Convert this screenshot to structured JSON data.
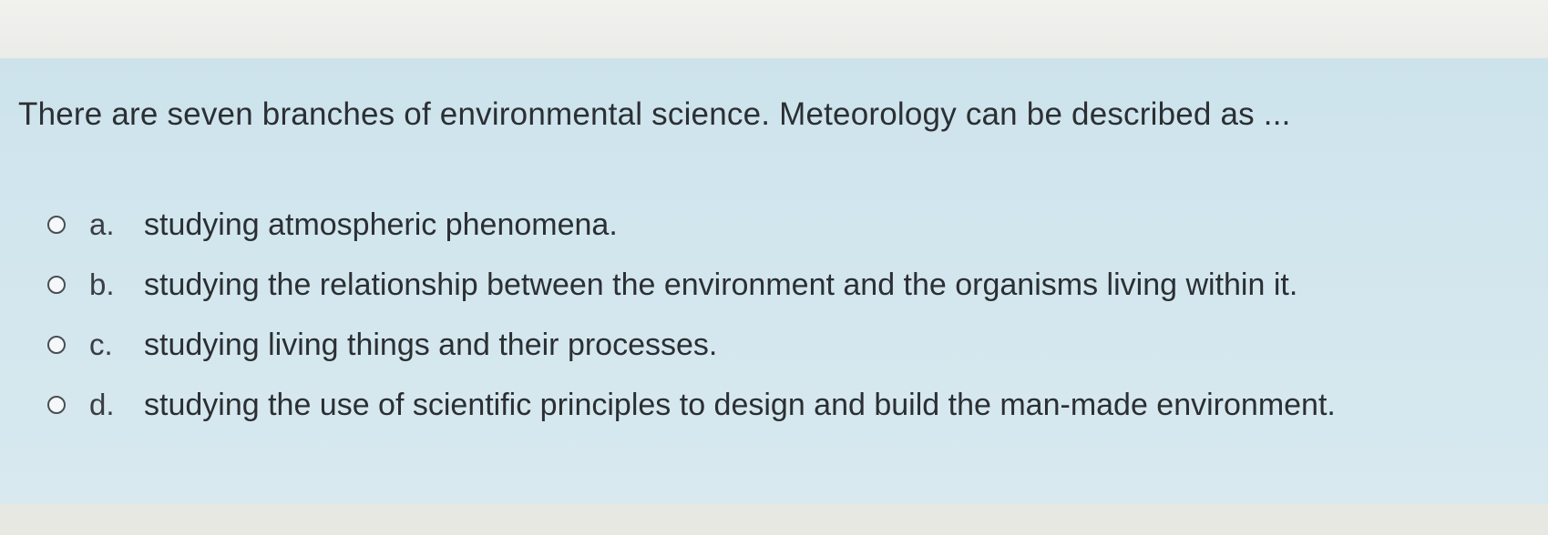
{
  "question": {
    "text": "There are seven branches of environmental science. Meteorology can be described as ..."
  },
  "options": [
    {
      "letter": "a.",
      "text": "studying atmospheric phenomena."
    },
    {
      "letter": "b.",
      "text": "studying the relationship between the environment and the organisms living within it."
    },
    {
      "letter": "c.",
      "text": "studying living things and their processes."
    },
    {
      "letter": "d.",
      "text": "studying the use of scientific principles to design and build the man-made environment."
    }
  ]
}
